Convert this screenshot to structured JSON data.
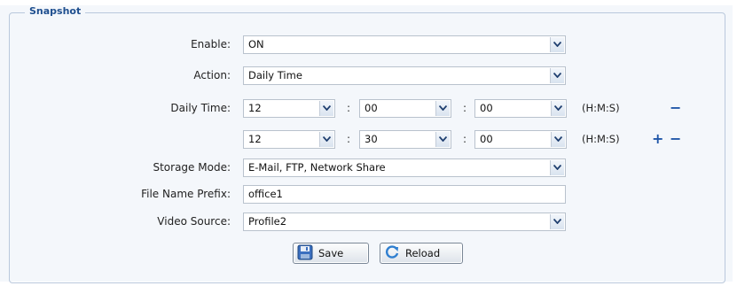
{
  "section": {
    "legend": "Snapshot"
  },
  "fields": {
    "enable": {
      "label": "Enable:",
      "value": "ON"
    },
    "action": {
      "label": "Action:",
      "value": "Daily Time"
    },
    "daily_time": {
      "label": "Daily Time:",
      "rows": [
        {
          "h": "12",
          "m": "00",
          "s": "00",
          "unit": "(H:M:S)",
          "controls": [
            "remove"
          ]
        },
        {
          "h": "12",
          "m": "30",
          "s": "00",
          "unit": "(H:M:S)",
          "controls": [
            "add",
            "remove"
          ]
        }
      ],
      "separator": ":",
      "add_symbol": "+",
      "remove_symbol": "−"
    },
    "storage_mode": {
      "label": "Storage Mode:",
      "value": "E-Mail, FTP, Network Share"
    },
    "file_name_prefix": {
      "label": "File Name Prefix:",
      "value": "office1"
    },
    "video_source": {
      "label": "Video Source:",
      "value": "Profile2"
    }
  },
  "buttons": {
    "save": "Save",
    "reload": "Reload"
  },
  "icons": {
    "dropdown": "chevron-down-icon",
    "save": "floppy-disk-icon",
    "reload": "refresh-icon",
    "add": "plus-icon",
    "remove": "minus-icon"
  },
  "colors": {
    "accent": "#1f56a8",
    "legend": "#1f4f8f",
    "panel": "#f4f7fb",
    "border": "#b9c8dc"
  }
}
